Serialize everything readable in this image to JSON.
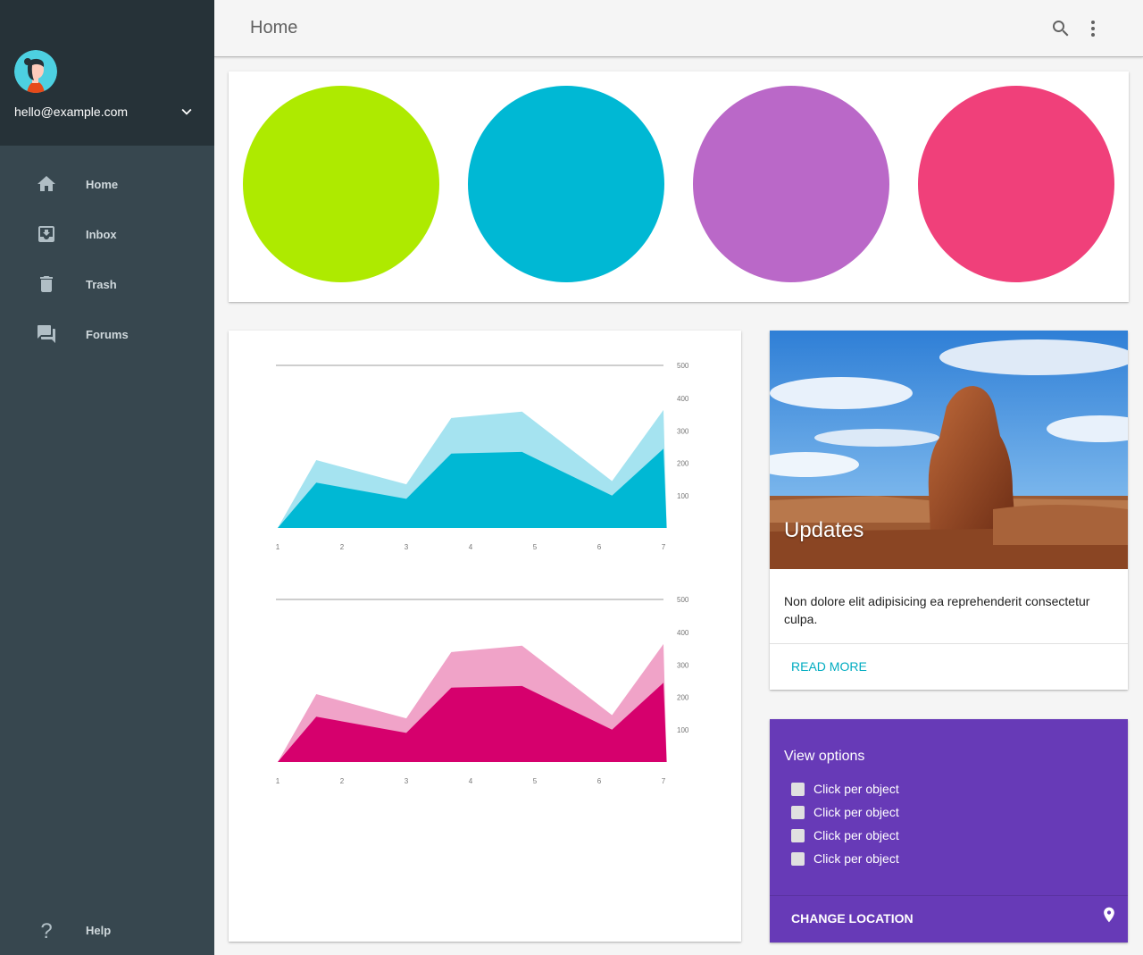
{
  "drawer": {
    "email": "hello@example.com",
    "items": [
      {
        "label": "Home",
        "icon": "home-icon"
      },
      {
        "label": "Inbox",
        "icon": "inbox-icon"
      },
      {
        "label": "Trash",
        "icon": "trash-icon"
      },
      {
        "label": "Forums",
        "icon": "forum-icon"
      }
    ],
    "help_label": "Help"
  },
  "header": {
    "title": "Home",
    "icons": [
      "search-icon",
      "more-vert-icon"
    ]
  },
  "circles": {
    "colors": [
      "#aeea00",
      "#00b8d4",
      "#ba68c8",
      "#f0407a"
    ]
  },
  "chart_data": [
    {
      "type": "area",
      "x": [
        1,
        2,
        3,
        4,
        5,
        6,
        7
      ],
      "x_ticks": [
        "1",
        "2",
        "3",
        "4",
        "5",
        "6",
        "7"
      ],
      "y_ticks": [
        "500",
        "400",
        "300",
        "200",
        "100"
      ],
      "ylim": [
        0,
        500
      ],
      "colors": [
        "#a5e3f0",
        "#00b8d4"
      ],
      "series": [
        {
          "values": [
            0,
            210,
            135,
            340,
            360,
            145,
            365,
            0
          ]
        },
        {
          "values": [
            0,
            140,
            90,
            230,
            235,
            100,
            245,
            0
          ]
        }
      ],
      "x_positions": [
        1,
        1.6,
        3,
        3.7,
        4.8,
        6.2,
        7,
        7.05
      ]
    },
    {
      "type": "area",
      "x": [
        1,
        2,
        3,
        4,
        5,
        6,
        7
      ],
      "x_ticks": [
        "1",
        "2",
        "3",
        "4",
        "5",
        "6",
        "7"
      ],
      "y_ticks": [
        "500",
        "400",
        "300",
        "200",
        "100"
      ],
      "ylim": [
        0,
        500
      ],
      "colors": [
        "#f0a3c8",
        "#d6006d"
      ],
      "series": [
        {
          "values": [
            0,
            210,
            135,
            340,
            360,
            145,
            365,
            0
          ]
        },
        {
          "values": [
            0,
            140,
            90,
            230,
            235,
            100,
            245,
            0
          ]
        }
      ],
      "x_positions": [
        1,
        1.6,
        3,
        3.7,
        4.8,
        6.2,
        7,
        7.05
      ]
    }
  ],
  "updates": {
    "title": "Updates",
    "text": "Non dolore elit adipisicing ea reprehenderit consectetur culpa.",
    "action": "READ MORE"
  },
  "options": {
    "title": "View options",
    "items": [
      "Click per object",
      "Click per object",
      "Click per object",
      "Click per object"
    ],
    "action": "CHANGE LOCATION"
  },
  "colors": {
    "drawer_bg": "#37474f",
    "drawer_header_bg": "#263238",
    "accent": "#00acc1",
    "options_bg": "#673ab7"
  }
}
